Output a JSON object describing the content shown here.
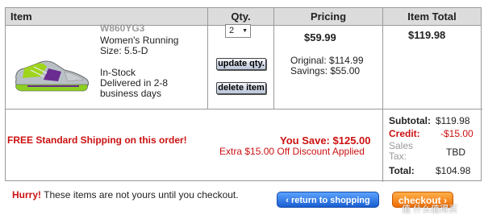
{
  "table": {
    "headers": {
      "item": "Item",
      "qty": "Qty.",
      "pricing": "Pricing",
      "item_total": "Item Total"
    }
  },
  "product": {
    "sku": "W860YG3",
    "name": "Women's Running",
    "size": "Size: 5.5-D",
    "stock": "In-Stock",
    "delivery": "Delivered in 2-8 business days",
    "qty": "2",
    "update_label": "update qty.",
    "delete_label": "delete item",
    "price": "$59.99",
    "original": "Original: $114.99",
    "savings": "Savings: $55.00",
    "item_total": "$119.98"
  },
  "promo": {
    "free_shipping": "FREE Standard Shipping on this order!",
    "you_save": "You Save: $125.00",
    "extra_discount": "Extra $15.00 Off Discount Applied"
  },
  "summary": {
    "subtotal_label": "Subtotal:",
    "subtotal_value": "$119.98",
    "credit_label": "Credit:",
    "credit_value": "-$15.00",
    "sales_label_1": "Sales",
    "sales_label_2": "Tax:",
    "sales_value": "TBD",
    "total_label": "Total:",
    "total_value": "$104.98"
  },
  "footer": {
    "hurry_strong": "Hurry!",
    "hurry_text": " These items are not yours until you checkout.",
    "return_label": "‹ return to shopping",
    "checkout_label": "checkout ›",
    "watermark": "值 什么值得买"
  },
  "colors": {
    "accent_red": "#cc1111",
    "header_bg": "#dcdcdc",
    "return_blue": "#1a5fd1",
    "checkout_orange": "#ef6d05"
  }
}
